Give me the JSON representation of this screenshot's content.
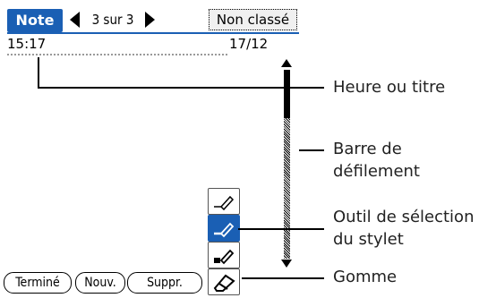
{
  "app": {
    "tab_label": "Note",
    "page_indicator": "3 sur 3",
    "category": "Non classé",
    "time": "15:17",
    "date": "17/12"
  },
  "buttons": {
    "done": "Terminé",
    "new": "Nouv.",
    "delete": "Suppr."
  },
  "icons": {
    "prev": "arrow-left-icon",
    "next": "arrow-right-icon",
    "scroll_up": "scroll-up-arrow-icon",
    "scroll_down": "scroll-down-arrow-icon",
    "pen_thin": "pen-thin-icon",
    "pen_medium": "pen-medium-icon",
    "pen_thick": "pen-thick-icon",
    "eraser": "eraser-icon"
  },
  "callouts": {
    "time_title": "Heure ou titre",
    "scrollbar_line1": "Barre de",
    "scrollbar_line2": "défilement",
    "stylus_line1": "Outil de sélection",
    "stylus_line2": "du stylet",
    "eraser": "Gomme"
  },
  "colors": {
    "accent": "#1a5fb4"
  }
}
